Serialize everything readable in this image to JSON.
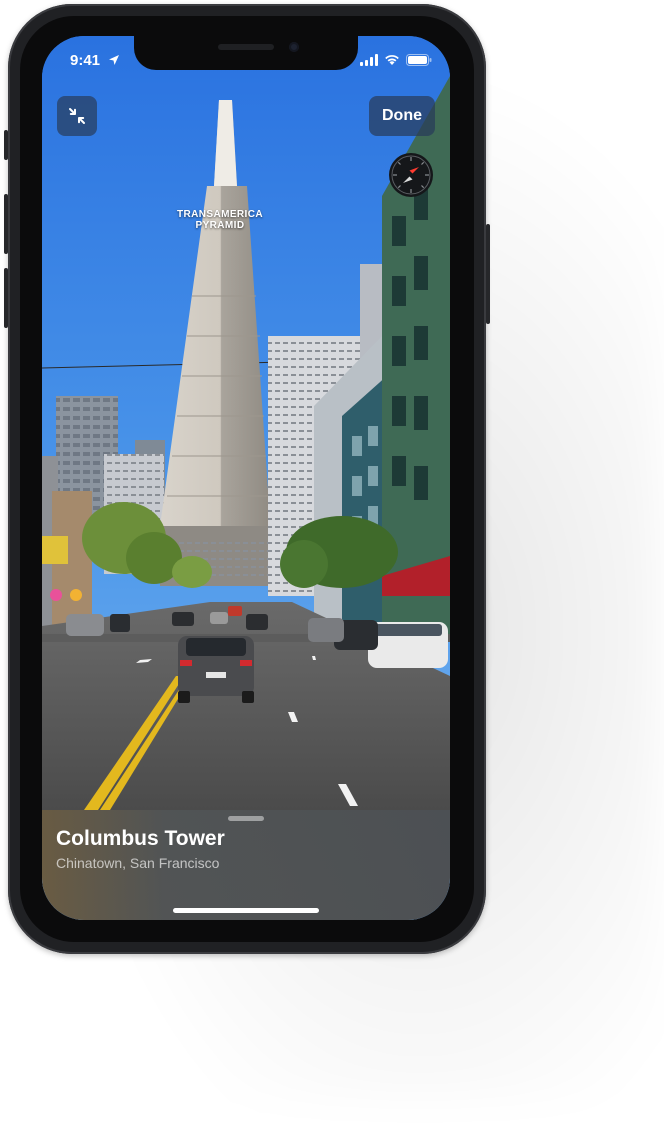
{
  "status_bar": {
    "time": "9:41",
    "location_icon": "location-arrow-icon",
    "cellular_icon": "cellular-signal-icon",
    "wifi_icon": "wifi-icon",
    "battery_icon": "battery-icon"
  },
  "controls": {
    "collapse_icon": "collapse-arrows-icon",
    "done_label": "Done",
    "compass_icon": "compass-icon"
  },
  "scene": {
    "poi_label_line1": "TRANSAMERICA",
    "poi_label_line2": "PYRAMID"
  },
  "place_card": {
    "title": "Columbus Tower",
    "subtitle": "Chinatown, San Francisco"
  },
  "colors": {
    "sky": "#2f7be0",
    "button_bg": "#2c3f5c",
    "compass_red": "#ff3b30"
  }
}
